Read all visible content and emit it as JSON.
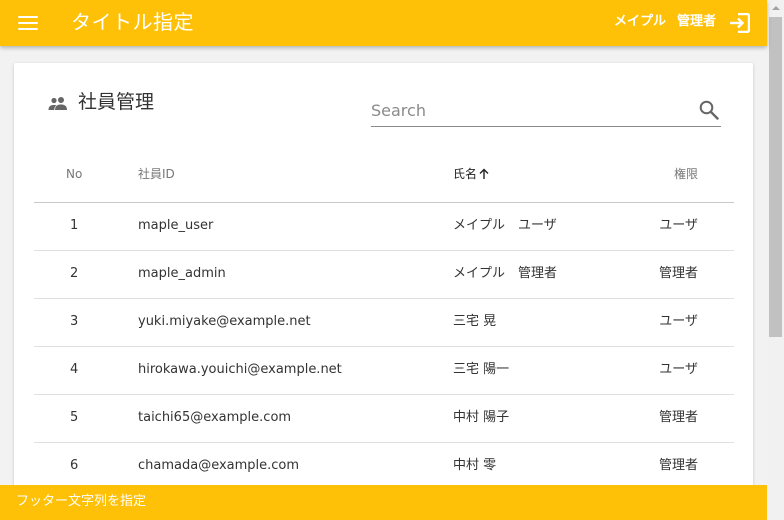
{
  "header": {
    "title": "タイトル指定",
    "user_name": "メイプル",
    "user_role": "管理者",
    "icons": {
      "menu": "menu-icon",
      "logout": "logout-icon"
    }
  },
  "card": {
    "title": "社員管理",
    "icon": "people-icon",
    "search": {
      "placeholder": "Search",
      "value": ""
    }
  },
  "table": {
    "columns": {
      "no": "No",
      "id": "社員ID",
      "name": "氏名",
      "role": "権限"
    },
    "sort": {
      "column": "name",
      "direction": "asc"
    },
    "rows": [
      {
        "no": "1",
        "id": "maple_user",
        "name": "メイプル　ユーザ",
        "role": "ユーザ"
      },
      {
        "no": "2",
        "id": "maple_admin",
        "name": "メイプル　管理者",
        "role": "管理者"
      },
      {
        "no": "3",
        "id": "yuki.miyake@example.net",
        "name": "三宅 晃",
        "role": "ユーザ"
      },
      {
        "no": "4",
        "id": "hirokawa.youichi@example.net",
        "name": "三宅 陽一",
        "role": "ユーザ"
      },
      {
        "no": "5",
        "id": "taichi65@example.com",
        "name": "中村 陽子",
        "role": "管理者"
      },
      {
        "no": "6",
        "id": "chamada@example.com",
        "name": "中村 零",
        "role": "管理者"
      }
    ]
  },
  "footer": {
    "text": "フッター文字列を指定"
  },
  "colors": {
    "accent": "#ffc107",
    "scroll_thumb": "#c1c1c1"
  }
}
